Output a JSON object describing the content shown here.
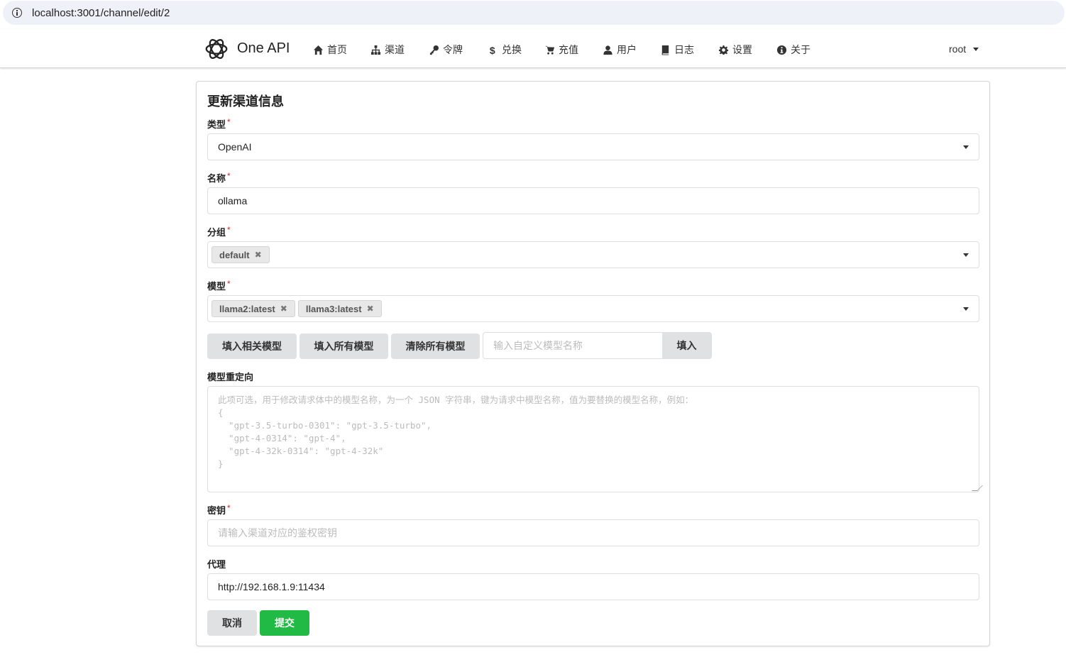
{
  "browser": {
    "url": "localhost:3001/channel/edit/2"
  },
  "nav": {
    "brand": "One API",
    "items": [
      {
        "label": "首页",
        "icon": "home-icon"
      },
      {
        "label": "渠道",
        "icon": "sitemap-icon"
      },
      {
        "label": "令牌",
        "icon": "key-icon"
      },
      {
        "label": "兑换",
        "icon": "dollar-icon"
      },
      {
        "label": "充值",
        "icon": "cart-icon"
      },
      {
        "label": "用户",
        "icon": "user-icon"
      },
      {
        "label": "日志",
        "icon": "book-icon"
      },
      {
        "label": "设置",
        "icon": "gear-icon"
      },
      {
        "label": "关于",
        "icon": "info-circle-icon"
      }
    ],
    "user": "root"
  },
  "form": {
    "title": "更新渠道信息",
    "type": {
      "label": "类型",
      "required": "*",
      "value": "OpenAI"
    },
    "name": {
      "label": "名称",
      "required": "*",
      "value": "ollama"
    },
    "group": {
      "label": "分组",
      "required": "*",
      "tags": [
        "default"
      ]
    },
    "models": {
      "label": "模型",
      "required": "*",
      "tags": [
        "llama2:latest",
        "llama3:latest"
      ]
    },
    "model_buttons": {
      "fill_related": "填入相关模型",
      "fill_all": "填入所有模型",
      "clear_all": "清除所有模型",
      "custom_placeholder": "输入自定义模型名称",
      "fill": "填入"
    },
    "model_mapping": {
      "label": "模型重定向",
      "placeholder": "此项可选，用于修改请求体中的模型名称，为一个 JSON 字符串，键为请求中模型名称，值为要替换的模型名称，例如：\n{\n  \"gpt-3.5-turbo-0301\": \"gpt-3.5-turbo\",\n  \"gpt-4-0314\": \"gpt-4\",\n  \"gpt-4-32k-0314\": \"gpt-4-32k\"\n}"
    },
    "key": {
      "label": "密钥",
      "required": "*",
      "placeholder": "请输入渠道对应的鉴权密钥"
    },
    "proxy": {
      "label": "代理",
      "value": "http://192.168.1.9:11434"
    },
    "cancel": "取消",
    "submit": "提交"
  },
  "colors": {
    "submit": "#21ba45",
    "required": "#db2828",
    "button": "#e0e1e2"
  }
}
